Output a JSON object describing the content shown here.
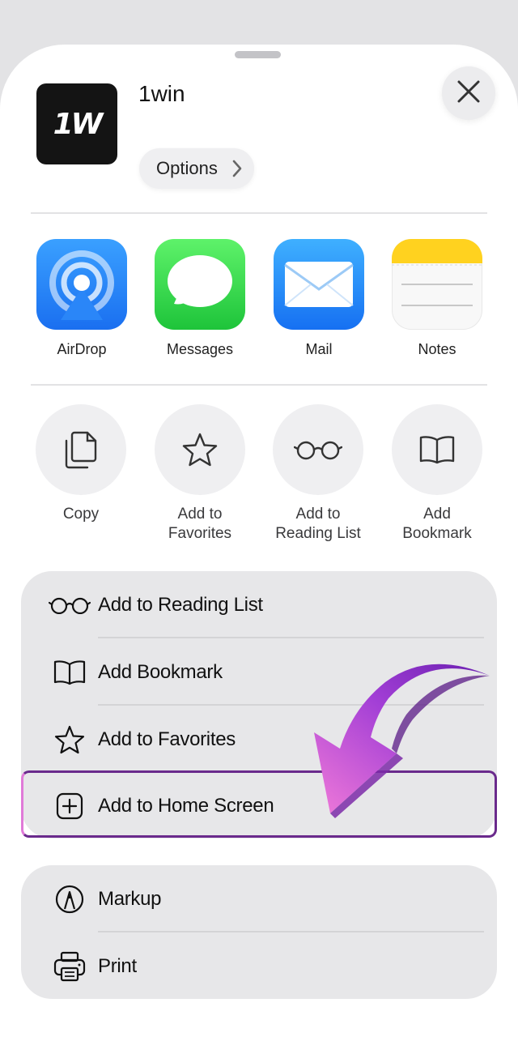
{
  "header": {
    "app_name": "1win",
    "logo_text": "1W",
    "options_label": "Options"
  },
  "share_apps": [
    {
      "label": "AirDrop",
      "icon": "airdrop-icon"
    },
    {
      "label": "Messages",
      "icon": "messages-icon"
    },
    {
      "label": "Mail",
      "icon": "mail-icon"
    },
    {
      "label": "Notes",
      "icon": "notes-icon"
    }
  ],
  "actions": [
    {
      "label_line1": "Copy",
      "label_line2": "",
      "icon": "copy-icon"
    },
    {
      "label_line1": "Add to",
      "label_line2": "Favorites",
      "icon": "star-icon"
    },
    {
      "label_line1": "Add to",
      "label_line2": "Reading List",
      "icon": "glasses-icon"
    },
    {
      "label_line1": "Add",
      "label_line2": "Bookmark",
      "icon": "book-icon"
    }
  ],
  "list_group_1": [
    {
      "label": "Add to Reading List",
      "icon": "glasses-icon"
    },
    {
      "label": "Add Bookmark",
      "icon": "book-icon"
    },
    {
      "label": "Add to Favorites",
      "icon": "star-icon"
    },
    {
      "label": "Add to Home Screen",
      "icon": "plus-square-icon",
      "highlighted": true
    }
  ],
  "list_group_2": [
    {
      "label": "Markup",
      "icon": "markup-icon"
    },
    {
      "label": "Print",
      "icon": "printer-icon"
    }
  ],
  "colors": {
    "highlight_border": "#6a2a8c",
    "arrow_gradient_start": "#f07ad8",
    "arrow_gradient_end": "#6a1fb0"
  }
}
